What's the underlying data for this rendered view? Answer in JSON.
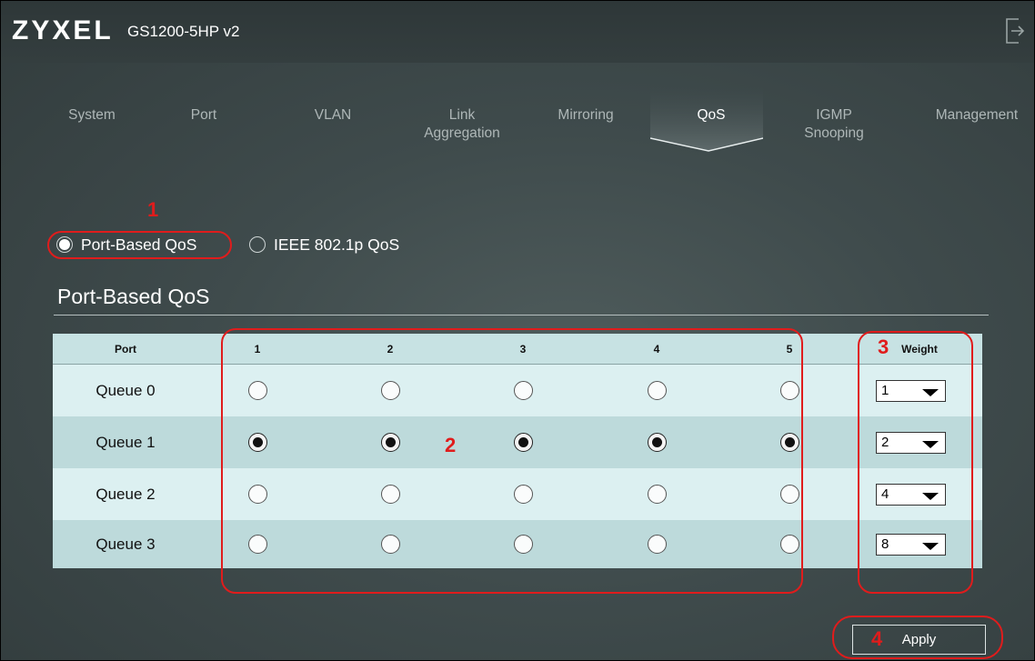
{
  "header": {
    "logo": "ZYXEL",
    "model": "GS1200-5HP v2",
    "logout_icon": "logout-icon"
  },
  "tabs": [
    {
      "label": "System",
      "active": false
    },
    {
      "label": "Port",
      "active": false
    },
    {
      "label": "VLAN",
      "active": false
    },
    {
      "label": "Link\nAggregation",
      "active": false
    },
    {
      "label": "Mirroring",
      "active": false
    },
    {
      "label": "QoS",
      "active": true
    },
    {
      "label": "IGMP\nSnooping",
      "active": false
    },
    {
      "label": "Management",
      "active": false
    }
  ],
  "qos_mode": {
    "options": [
      "Port-Based QoS",
      "IEEE 802.1p QoS"
    ],
    "selected": "Port-Based QoS"
  },
  "section": {
    "title": "Port-Based QoS"
  },
  "table": {
    "port_header": "Port",
    "ports": [
      "1",
      "2",
      "3",
      "4",
      "5"
    ],
    "weight_header": "Weight",
    "rows": [
      {
        "name": "Queue 0",
        "selected_ports": [],
        "weight": "1"
      },
      {
        "name": "Queue 1",
        "selected_ports": [
          "1",
          "2",
          "3",
          "4",
          "5"
        ],
        "weight": "2"
      },
      {
        "name": "Queue 2",
        "selected_ports": [],
        "weight": "4"
      },
      {
        "name": "Queue 3",
        "selected_ports": [],
        "weight": "8"
      }
    ]
  },
  "apply_label": "Apply",
  "annotations": [
    "1",
    "2",
    "3",
    "4"
  ],
  "colors": {
    "annotation": "#e01c1c",
    "background": "#3f4b4c",
    "row_light": "#dcf0f1",
    "row_dark": "#bddadb"
  }
}
